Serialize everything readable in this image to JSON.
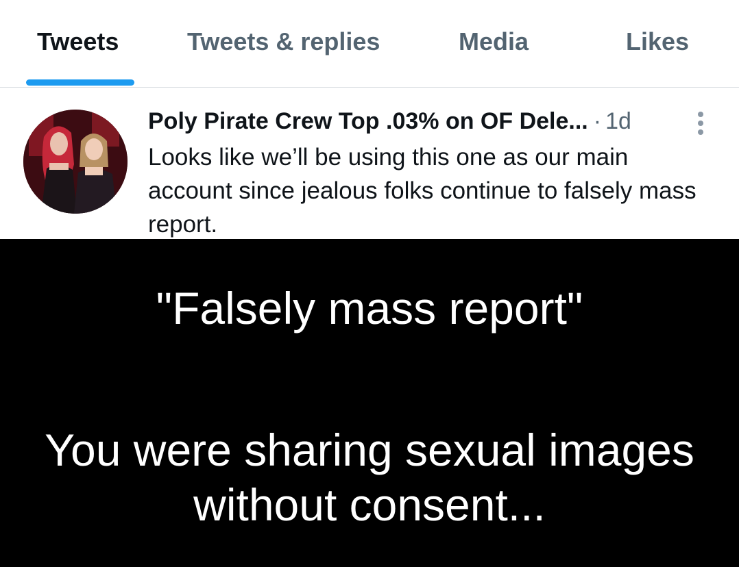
{
  "tabs": [
    {
      "label": "Tweets",
      "active": true
    },
    {
      "label": "Tweets & replies",
      "active": false
    },
    {
      "label": "Media",
      "active": false
    },
    {
      "label": "Likes",
      "active": false
    }
  ],
  "tweet": {
    "author_name": "Poly Pirate Crew Top .03% on OF Dele...",
    "separator": "·",
    "timestamp": "1d",
    "text": "Looks like we’ll be using this one as our main account since jealous folks continue to falsely mass report.",
    "avatar": "profile-photo-two-people",
    "more_icon": "more-vertical-icon"
  },
  "meme": {
    "line1": "\"Falsely mass report\"",
    "line2": "You were sharing sexual images without consent..."
  },
  "colors": {
    "accent": "#1d9bf0",
    "text_primary": "#0f1419",
    "text_secondary": "#536471",
    "meme_background": "#000000",
    "meme_text": "#ffffff"
  }
}
